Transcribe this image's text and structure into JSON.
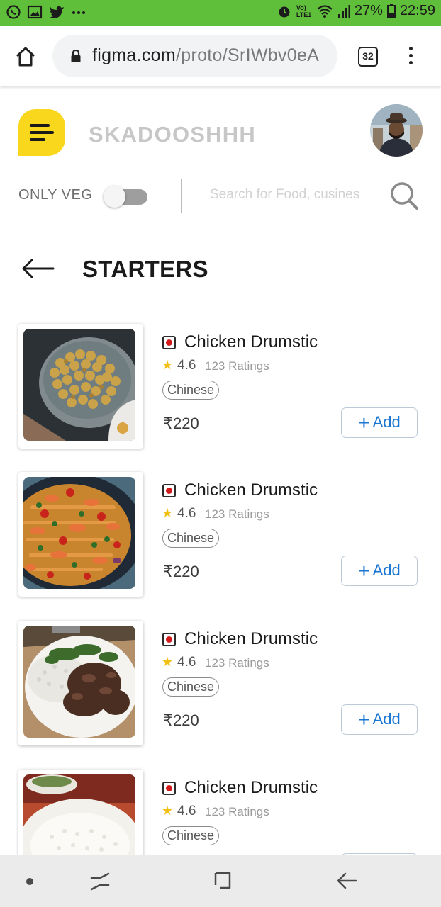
{
  "status_bar": {
    "left_icons": [
      "whatsapp-icon",
      "gallery-icon",
      "twitter-icon",
      "more-dots-icon"
    ],
    "network_label": "Vo) LTE1",
    "battery_percent": "27%",
    "time": "22:59"
  },
  "browser": {
    "url_host": "figma.com",
    "url_path": "/proto/SrIWbv0eA",
    "tab_count": "32"
  },
  "app": {
    "brand": "SKADOOSHHH",
    "veg_label": "ONLY VEG",
    "veg_toggle_on": false,
    "search_placeholder": "Search for Food, cusines"
  },
  "section": {
    "title": "STARTERS"
  },
  "colors": {
    "status_bar": "#5fbf3a",
    "logo_yellow": "#f9d71c",
    "accent_blue": "#1976d2",
    "nonveg_red": "#d21a1a",
    "star": "#f2c012"
  },
  "items": [
    {
      "name": "Chicken Drumstic",
      "rating": "4.6",
      "ratings_count": "123 Ratings",
      "cuisine": "Chinese",
      "price": "₹220",
      "add_label": "Add",
      "image": "chickpeas-bowl"
    },
    {
      "name": "Chicken Drumstic",
      "rating": "4.6",
      "ratings_count": "123 Ratings",
      "cuisine": "Chinese",
      "price": "₹220",
      "add_label": "Add",
      "image": "paella-pan"
    },
    {
      "name": "Chicken Drumstic",
      "rating": "4.6",
      "ratings_count": "123 Ratings",
      "cuisine": "Chinese",
      "price": "₹220",
      "add_label": "Add",
      "image": "meat-rice-plate"
    },
    {
      "name": "Chicken Drumstic",
      "rating": "4.6",
      "ratings_count": "123 Ratings",
      "cuisine": "Chinese",
      "image": "rice-bowl"
    }
  ]
}
